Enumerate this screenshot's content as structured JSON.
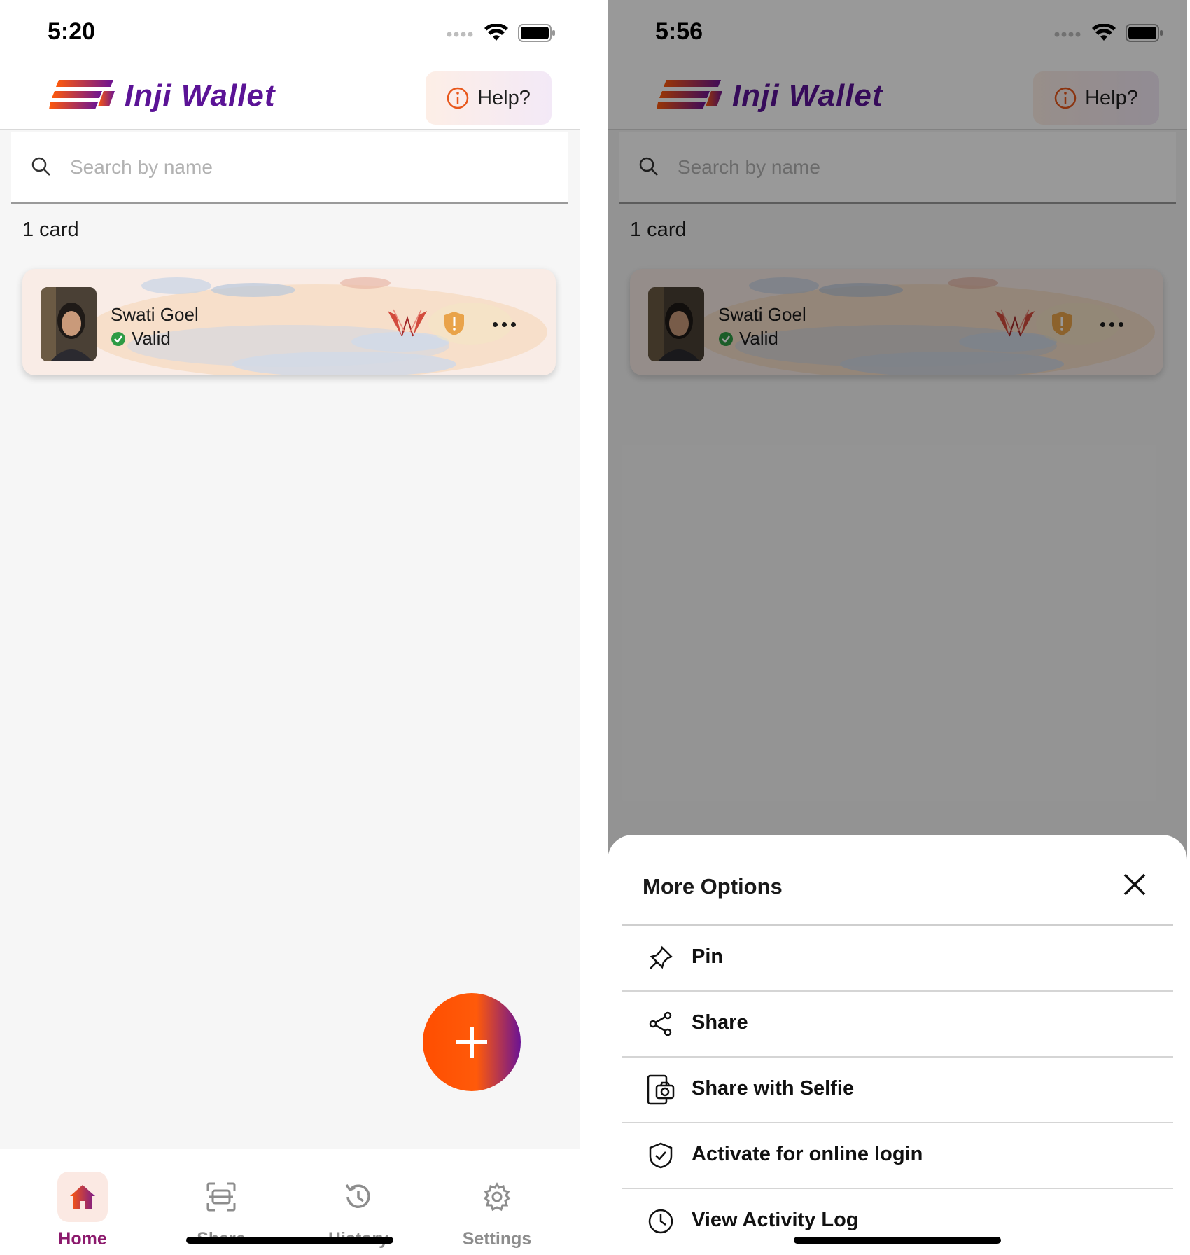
{
  "left_screen": {
    "status_time": "5:20",
    "app_title": "Inji Wallet",
    "help_label": "Help?",
    "search_placeholder": "Search by name",
    "card_count": "1 card",
    "card": {
      "name": "Swati Goel",
      "status": "Valid"
    },
    "nav": {
      "home": "Home",
      "share": "Share",
      "history": "History",
      "settings": "Settings"
    }
  },
  "right_screen": {
    "status_time": "5:56",
    "app_title": "Inji Wallet",
    "help_label": "Help?",
    "search_placeholder": "Search by name",
    "card_count": "1 card",
    "card": {
      "name": "Swati Goel",
      "status": "Valid"
    },
    "sheet": {
      "title": "More Options",
      "options": [
        {
          "label": "Pin",
          "icon": "pin-icon"
        },
        {
          "label": "Share",
          "icon": "share-icon"
        },
        {
          "label": "Share with Selfie",
          "icon": "share-selfie-icon"
        },
        {
          "label": "Activate for online login",
          "icon": "shield-check-icon"
        },
        {
          "label": "View Activity Log",
          "icon": "clock-icon"
        }
      ]
    }
  },
  "colors": {
    "brand_purple": "#5b1396",
    "brand_orange": "#ff5a0a",
    "active_nav": "#8c1a6d",
    "valid_green": "#2e9b44"
  }
}
